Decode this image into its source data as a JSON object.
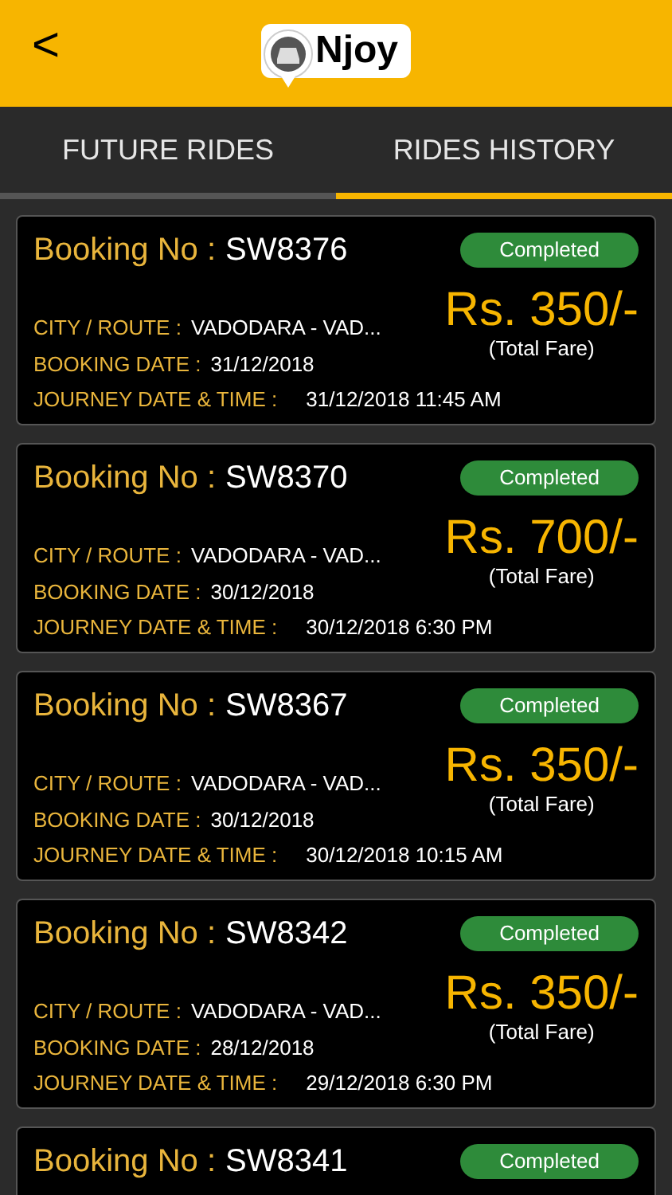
{
  "header": {
    "back": "<",
    "logo_text": "Njoy"
  },
  "tabs": [
    {
      "label": "FUTURE RIDES",
      "selected": false
    },
    {
      "label": "RIDES HISTORY",
      "selected": true
    }
  ],
  "bookings": [
    {
      "booking_label": "Booking No :",
      "booking_no": "SW8376",
      "status": "Completed",
      "route_label": "CITY / ROUTE :",
      "route": "VADODARA - VAD...",
      "booking_date_label": "BOOKING DATE :",
      "booking_date": "31/12/2018",
      "journey_label": "JOURNEY DATE & TIME :",
      "journey": "31/12/2018 11:45 AM",
      "fare": "Rs. 350/-",
      "fare_note": "(Total Fare)"
    },
    {
      "booking_label": "Booking No :",
      "booking_no": "SW8370",
      "status": "Completed",
      "route_label": "CITY / ROUTE :",
      "route": "VADODARA - VAD...",
      "booking_date_label": "BOOKING DATE :",
      "booking_date": "30/12/2018",
      "journey_label": "JOURNEY DATE & TIME :",
      "journey": "30/12/2018 6:30 PM",
      "fare": "Rs. 700/-",
      "fare_note": "(Total Fare)"
    },
    {
      "booking_label": "Booking No :",
      "booking_no": "SW8367",
      "status": "Completed",
      "route_label": "CITY / ROUTE :",
      "route": "VADODARA - VAD...",
      "booking_date_label": "BOOKING DATE :",
      "booking_date": "30/12/2018",
      "journey_label": "JOURNEY DATE & TIME :",
      "journey": "30/12/2018 10:15 AM",
      "fare": "Rs. 350/-",
      "fare_note": "(Total Fare)"
    },
    {
      "booking_label": "Booking No :",
      "booking_no": "SW8342",
      "status": "Completed",
      "route_label": "CITY / ROUTE :",
      "route": "VADODARA - VAD...",
      "booking_date_label": "BOOKING DATE :",
      "booking_date": "28/12/2018",
      "journey_label": "JOURNEY DATE & TIME :",
      "journey": "29/12/2018 6:30 PM",
      "fare": "Rs. 350/-",
      "fare_note": "(Total Fare)"
    },
    {
      "booking_label": "Booking No :",
      "booking_no": "SW8341",
      "status": "Completed"
    }
  ]
}
